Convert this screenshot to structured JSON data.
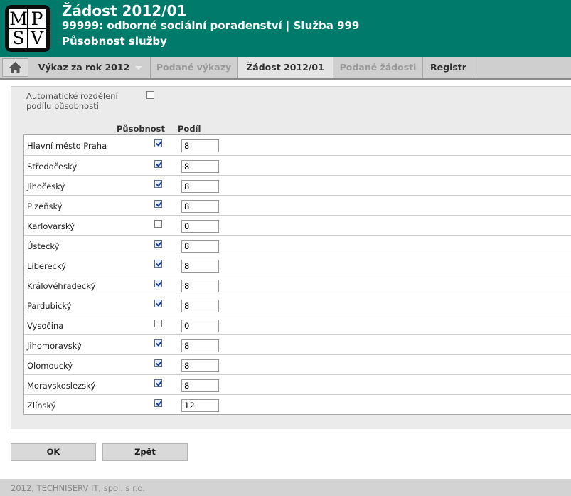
{
  "header": {
    "logo": {
      "letters": [
        "M",
        "P",
        "S",
        "V"
      ]
    },
    "title": "Žádost 2012/01",
    "subtitle": "99999: odborné sociální poradenství | Služba 999",
    "section": "Působnost služby"
  },
  "nav": {
    "home_icon": "home-icon",
    "items": [
      {
        "label": "Výkaz za rok 2012",
        "state": "normal",
        "has_dropdown": true
      },
      {
        "label": "Podané výkazy",
        "state": "disabled"
      },
      {
        "label": "Žádost 2012/01",
        "state": "active"
      },
      {
        "label": "Podané žádosti",
        "state": "disabled"
      },
      {
        "label": "Registr",
        "state": "normal"
      }
    ]
  },
  "form": {
    "auto_label": "Automatické rozdělení podílu působnosti",
    "auto_checked": false,
    "column_headers": {
      "pusobnost": "Působnost",
      "podil": "Podíl"
    },
    "regions": [
      {
        "name": "Hlavní město Praha",
        "checked": true,
        "share": "8"
      },
      {
        "name": "Středočeský",
        "checked": true,
        "share": "8"
      },
      {
        "name": "Jihočeský",
        "checked": true,
        "share": "8"
      },
      {
        "name": "Plzeňský",
        "checked": true,
        "share": "8"
      },
      {
        "name": "Karlovarský",
        "checked": false,
        "share": "0"
      },
      {
        "name": "Ústecký",
        "checked": true,
        "share": "8"
      },
      {
        "name": "Liberecký",
        "checked": true,
        "share": "8"
      },
      {
        "name": "Královéhradecký",
        "checked": true,
        "share": "8"
      },
      {
        "name": "Pardubický",
        "checked": true,
        "share": "8"
      },
      {
        "name": "Vysočina",
        "checked": false,
        "share": "0"
      },
      {
        "name": "Jihomoravský",
        "checked": true,
        "share": "8"
      },
      {
        "name": "Olomoucký",
        "checked": true,
        "share": "8"
      },
      {
        "name": "Moravskoslezský",
        "checked": true,
        "share": "8"
      },
      {
        "name": "Zlínský",
        "checked": true,
        "share": "12"
      }
    ]
  },
  "buttons": {
    "ok": "OK",
    "back": "Zpět"
  },
  "footer": {
    "text": "2012, TECHNISERV IT, spol. s r.o."
  },
  "colors": {
    "header_bg": "#007a6a",
    "nav_bg": "#cfcfcf",
    "panel_bg": "#ebebeb"
  }
}
